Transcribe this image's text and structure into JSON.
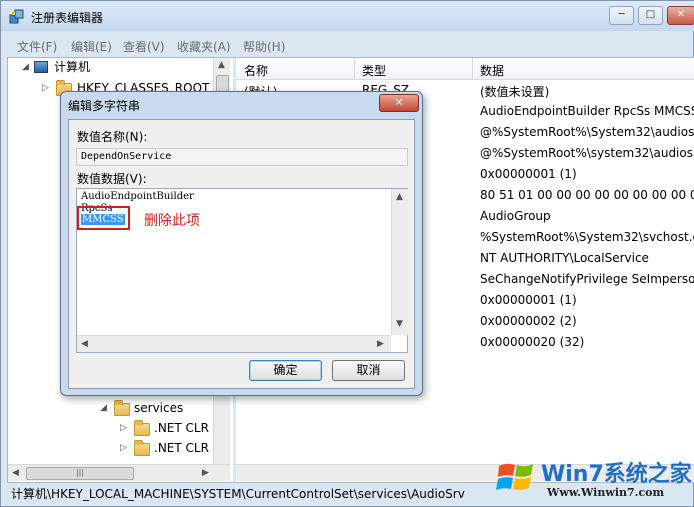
{
  "window": {
    "title": "注册表编辑器",
    "controls": {
      "minimize": "─",
      "maximize": "□",
      "close": "✕"
    }
  },
  "menu": [
    "文件(F)",
    "编辑(E)",
    "查看(V)",
    "收藏夹(A)",
    "帮助(H)"
  ],
  "tree": {
    "root": "计算机",
    "hkcr": "HKEY_CLASSES_ROOT",
    "services": "services",
    "net_clr_1": ".NET CLR",
    "net_clr_2": ".NET CLR",
    "hscroll_thumb": "|||"
  },
  "list": {
    "headers": {
      "name": "名称",
      "type": "类型",
      "data": "数据"
    },
    "rows": [
      {
        "name": "(默认)",
        "type": "REG_SZ",
        "data": "(数值未设置)"
      },
      {
        "name": "",
        "type": "I_SZ",
        "data": "AudioEndpointBuilder RpcSs MMCSS"
      },
      {
        "name": "",
        "type": "",
        "data": "@%SystemRoot%\\System32\\audiosrv"
      },
      {
        "name": "",
        "type": "",
        "data": "@%SystemRoot%\\system32\\audiosrv"
      },
      {
        "name": "",
        "type": "RD",
        "data": "0x00000001 (1)"
      },
      {
        "name": "",
        "type": "RY",
        "data": "80 51 01 00 00 00 00 00 00 00 00 00"
      },
      {
        "name": "",
        "type": "",
        "data": "AudioGroup"
      },
      {
        "name": "",
        "type": "ND_SZ",
        "data": "%SystemRoot%\\System32\\svchost.ex"
      },
      {
        "name": "",
        "type": "",
        "data": "NT AUTHORITY\\LocalService"
      },
      {
        "name": "",
        "type": "I_SZ",
        "data": "SeChangeNotifyPrivilege SeImperson"
      },
      {
        "name": "",
        "type": "RD",
        "data": "0x00000001 (1)"
      },
      {
        "name": "",
        "type": "RD",
        "data": "0x00000002 (2)"
      },
      {
        "name": "",
        "type": "RD",
        "data": "0x00000020 (32)"
      }
    ]
  },
  "status": "计算机\\HKEY_LOCAL_MACHINE\\SYSTEM\\CurrentControlSet\\services\\AudioSrv",
  "dialog": {
    "title": "编辑多字符串",
    "close": "✕",
    "name_label": "数值名称(N):",
    "name_value": "DependOnService",
    "data_label": "数值数据(V):",
    "data_lines": [
      "AudioEndpointBuilder",
      "RpcSs",
      "MMCSS"
    ],
    "annotation": "删除此项",
    "ok": "确定",
    "cancel": "取消"
  },
  "watermark": {
    "brand": "Win7系统之家",
    "url": "Www.Winwin7.com"
  },
  "colors": {
    "window_frame": "#dbe6f3",
    "dialog_frame": "#c9daee",
    "selection": "#3399ff",
    "annotation_red": "#d11f1f",
    "close_red": "#c85846"
  }
}
